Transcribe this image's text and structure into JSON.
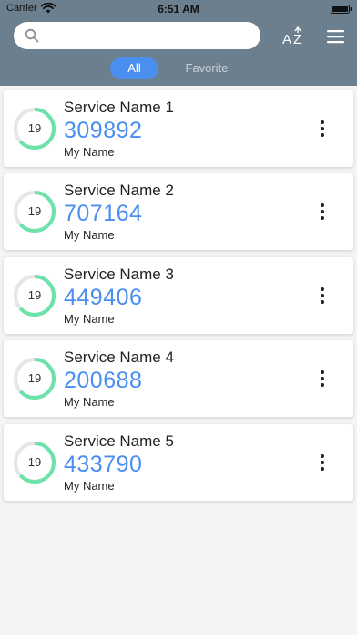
{
  "status_bar": {
    "carrier": "Carrier",
    "time": "6:51 AM"
  },
  "search": {
    "value": "",
    "placeholder": ""
  },
  "toolbar": {
    "sort_icon": "sort-az-icon",
    "menu_icon": "hamburger-menu-icon"
  },
  "tabs": [
    {
      "label": "All",
      "active": true
    },
    {
      "label": "Favorite",
      "active": false
    }
  ],
  "colors": {
    "header": "#6b7f8e",
    "accent": "#4a8ff0",
    "ring_progress": "#6ee2ab",
    "ring_track": "#e6e6e6"
  },
  "accounts": [
    {
      "service": "Service Name 1",
      "code": "309892",
      "account": "My Name",
      "seconds": "19",
      "remaining_fraction": 0.633
    },
    {
      "service": "Service Name 2",
      "code": "707164",
      "account": "My Name",
      "seconds": "19",
      "remaining_fraction": 0.633
    },
    {
      "service": "Service Name 3",
      "code": "449406",
      "account": "My Name",
      "seconds": "19",
      "remaining_fraction": 0.633
    },
    {
      "service": "Service Name 4",
      "code": "200688",
      "account": "My Name",
      "seconds": "19",
      "remaining_fraction": 0.633
    },
    {
      "service": "Service Name 5",
      "code": "433790",
      "account": "My Name",
      "seconds": "19",
      "remaining_fraction": 0.633
    }
  ]
}
